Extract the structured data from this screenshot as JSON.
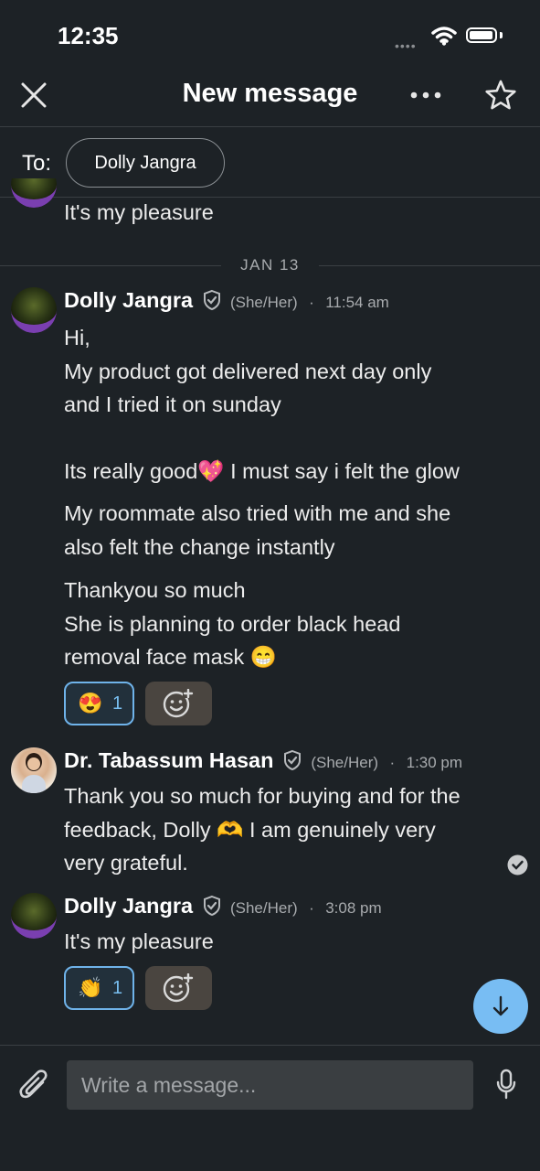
{
  "status_bar": {
    "time": "12:35",
    "signal_text": "••••"
  },
  "header": {
    "title": "New message",
    "close_icon": "close-icon",
    "more_icon": "more-icon",
    "star_icon": "star-icon"
  },
  "recipients": {
    "label": "To:",
    "chip": "Dolly Jangra"
  },
  "thread": {
    "previous_tail": "It's my pleasure",
    "date_separator": "JAN 13",
    "messages": [
      {
        "name": "Dolly Jangra",
        "pronouns": "(She/Her)",
        "time": "11:54 am",
        "lines": [
          "Hi,",
          "My product got delivered next day only",
          "and I tried it on sunday",
          "",
          "Its really good💖 I must say i felt the glow"
        ],
        "para2": [
          "My roommate also tried with me and she",
          "also felt the change instantly"
        ],
        "para3": [
          "Thankyou so much",
          "She is planning to order black head",
          "removal face mask 😁"
        ],
        "reaction": {
          "emoji": "😍",
          "count": "1"
        }
      },
      {
        "name": "Dr. Tabassum Hasan",
        "pronouns": "(She/Her)",
        "time": "1:30 pm",
        "lines": [
          "Thank you so much for buying and for the",
          "feedback, Dolly 🫶 I am genuinely very",
          "very grateful."
        ]
      },
      {
        "name": "Dolly Jangra",
        "pronouns": "(She/Her)",
        "time": "3:08 pm",
        "lines": [
          "It's my pleasure"
        ],
        "reaction": {
          "emoji": "👏",
          "count": "1"
        }
      }
    ]
  },
  "composer": {
    "placeholder": "Write a message..."
  },
  "colors": {
    "background": "#1d2226",
    "accent": "#78bdf3",
    "reaction_border": "#6fb3ea"
  }
}
